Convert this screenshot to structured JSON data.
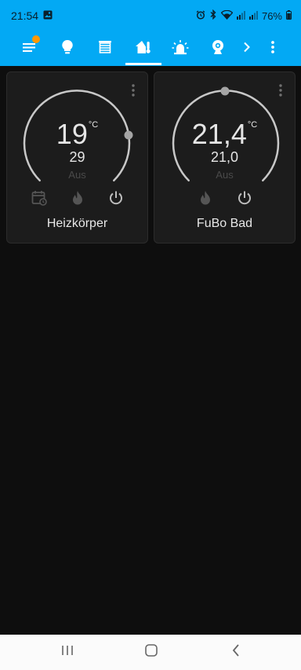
{
  "status": {
    "time": "21:54",
    "battery": "76%",
    "icons": [
      "image-icon",
      "alarm-icon",
      "bluetooth-icon",
      "wifi-icon",
      "signal-icon",
      "signal-icon",
      "battery-icon"
    ]
  },
  "toolbar": {
    "items": [
      {
        "name": "menu",
        "icon": "menu-icon"
      },
      {
        "name": "lights",
        "icon": "lightbulb-icon"
      },
      {
        "name": "blinds",
        "icon": "blinds-icon"
      },
      {
        "name": "heating",
        "icon": "home-thermometer-icon",
        "selected": true
      },
      {
        "name": "alarm",
        "icon": "alarm-light-icon"
      },
      {
        "name": "camera",
        "icon": "webcam-icon"
      },
      {
        "name": "more-tabs",
        "icon": "chevron-right-icon"
      },
      {
        "name": "overflow",
        "icon": "dots-vertical-icon"
      }
    ],
    "accent": "#03a9f4",
    "badge_color": "#ff9800"
  },
  "cards": [
    {
      "name": "Heizkörper",
      "current_temp": "19",
      "unit": "°C",
      "setpoint": "29",
      "mode": "Aus",
      "controls": [
        "calendar-clock-icon",
        "fire-icon",
        "power-icon"
      ]
    },
    {
      "name": "FuBo Bad",
      "current_temp": "21,4",
      "unit": "°C",
      "setpoint": "21,0",
      "mode": "Aus",
      "controls": [
        "fire-icon",
        "power-icon"
      ]
    }
  ],
  "nav": {
    "icons": [
      "recent-apps-icon",
      "home-icon",
      "back-icon"
    ]
  }
}
